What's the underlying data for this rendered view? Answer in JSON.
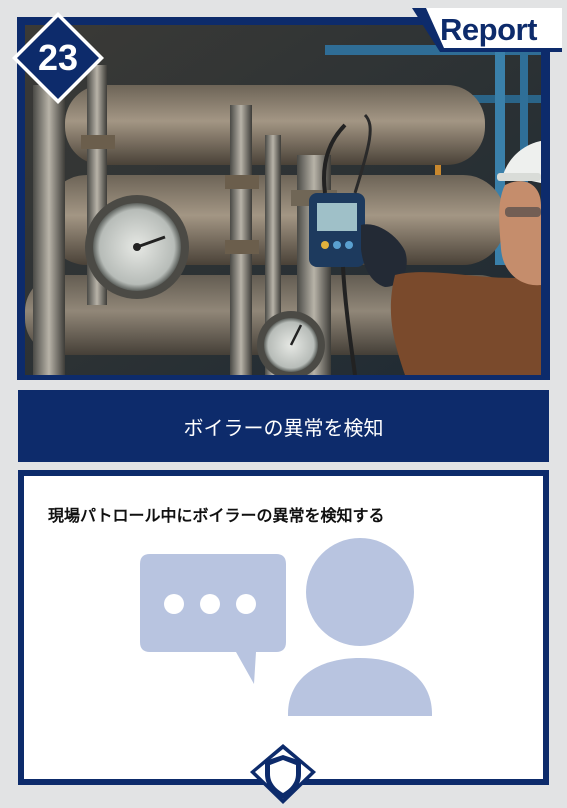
{
  "badge": {
    "number": "23"
  },
  "tab": {
    "label": "Report"
  },
  "title": "ボイラーの異常を検知",
  "description": "現場パトロール中にボイラーの異常を検知する",
  "colors": {
    "navy": "#0d2b6b",
    "background": "#e2e3e4",
    "illustration": "#b8c4e0"
  },
  "icons": [
    "chat-bubble-icon",
    "person-icon",
    "shield-icon"
  ]
}
